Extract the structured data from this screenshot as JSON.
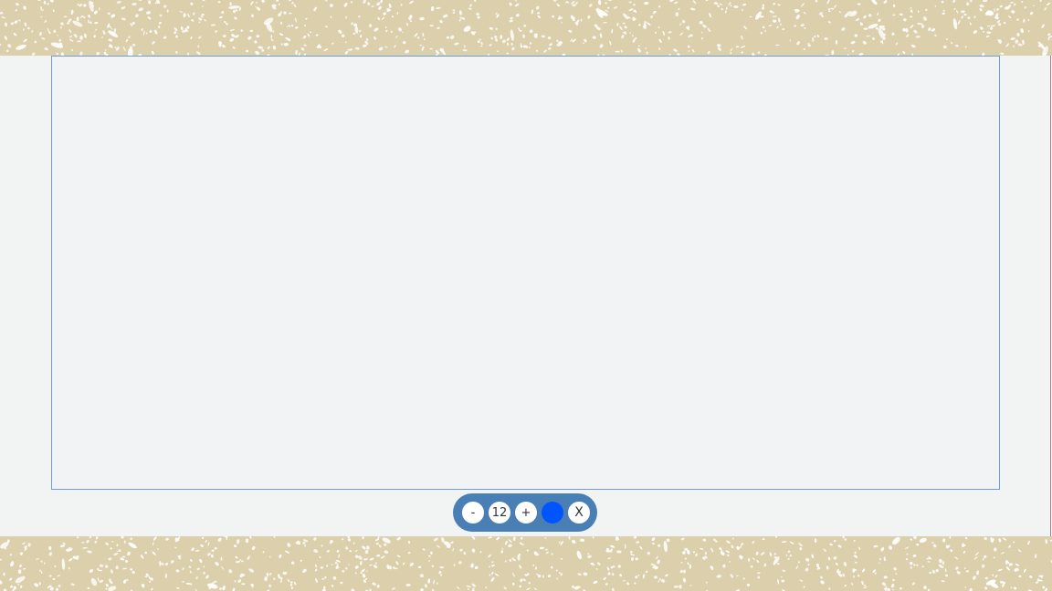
{
  "page": {
    "band_color": "#dccfac",
    "speckle_color": "#ffffff",
    "stage_color": "#f2f3f3"
  },
  "canvas": {
    "border_color": "#6f9fcf"
  },
  "toolbar": {
    "background": "#4a7fb5",
    "decrease_label": "-",
    "size_value": "12",
    "increase_label": "+",
    "color_value": "#0055ff",
    "close_label": "X"
  }
}
